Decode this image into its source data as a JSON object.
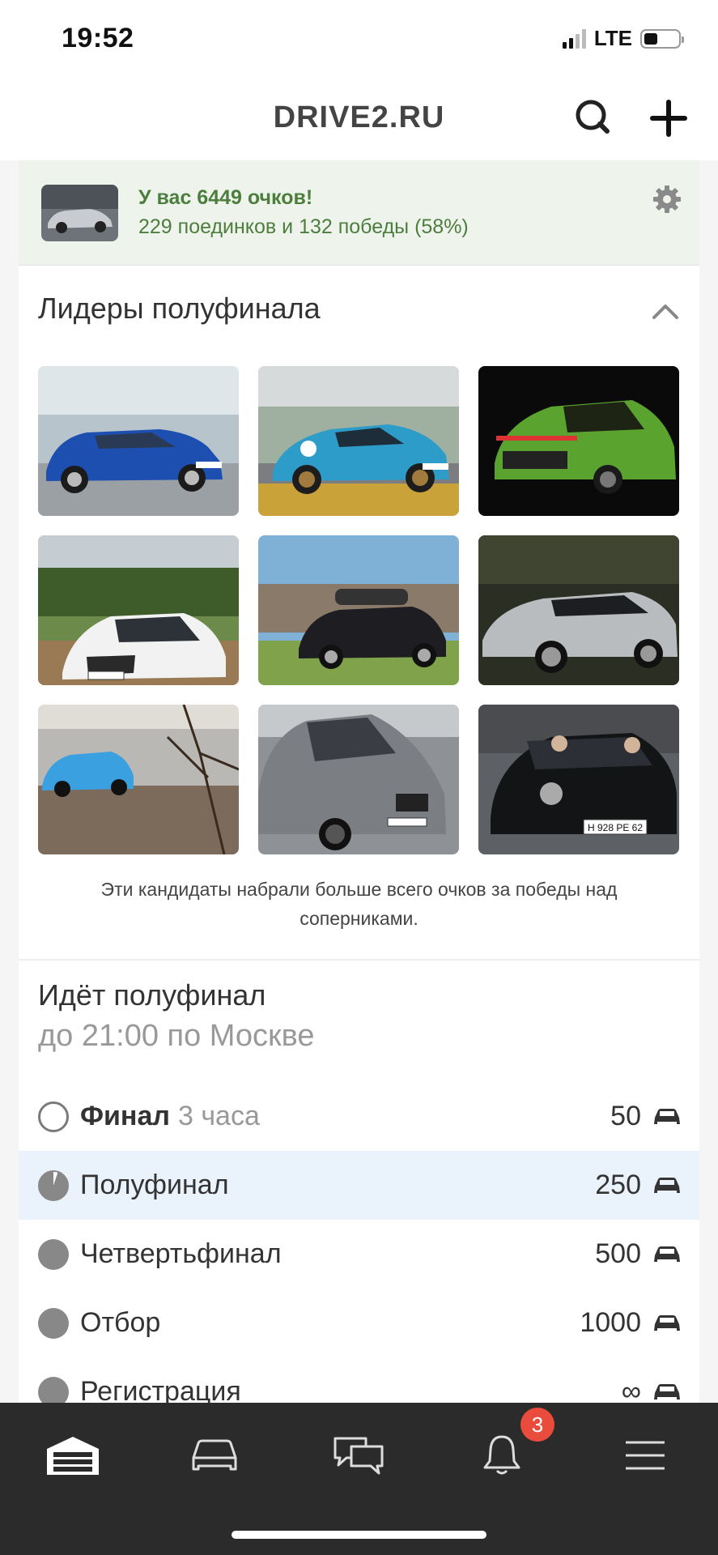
{
  "status_bar": {
    "time": "19:52",
    "network": "LTE",
    "battery_level": 0.4
  },
  "header": {
    "title": "DRIVE2.RU",
    "search_icon": "search-icon",
    "add_icon": "plus-icon"
  },
  "score": {
    "title": "У вас 6449 очков!",
    "subtitle": "229 поединков и 132 победы (58%)",
    "settings_icon": "gear-icon",
    "color": "#4d7e3e"
  },
  "leaders": {
    "title": "Лидеры полуфинала",
    "collapse_icon": "chevron-up-icon",
    "photos": [
      {
        "alt": "blue-sedan-photo",
        "plate": "A 963 C 190"
      },
      {
        "alt": "blue-porsche-photo",
        "plate": "T 966 PA"
      },
      {
        "alt": "green-suv-photo",
        "plate": ""
      },
      {
        "alt": "white-audi-photo",
        "plate": "A 463 C 190"
      },
      {
        "alt": "black-wagon-photo",
        "plate": ""
      },
      {
        "alt": "silver-sedan-photo",
        "plate": ""
      },
      {
        "alt": "blue-hatch-photo",
        "plate": ""
      },
      {
        "alt": "grey-skoda-photo",
        "plate": "AX 8811 MH"
      },
      {
        "alt": "black-porsche-photo",
        "plate": "H 928 PE 62"
      }
    ],
    "caption": "Эти кандидаты набрали больше всего очков за победы над соперниками."
  },
  "stage": {
    "title": "Идёт полуфинал",
    "subtitle": "до 21:00 по Москве",
    "rows": [
      {
        "name": "Финал",
        "duration": "3 часа",
        "value": "50",
        "state": "empty"
      },
      {
        "name": "Полуфинал",
        "duration": "",
        "value": "250",
        "state": "partial"
      },
      {
        "name": "Четвертьфинал",
        "duration": "",
        "value": "500",
        "state": "full"
      },
      {
        "name": "Отбор",
        "duration": "",
        "value": "1000",
        "state": "full"
      },
      {
        "name": "Регистрация",
        "duration": "",
        "value": "∞",
        "state": "full"
      }
    ]
  },
  "tabbar": {
    "tabs": [
      "garage-icon",
      "car-icon",
      "chat-icon",
      "bell-icon",
      "menu-icon"
    ],
    "notification_count": "3"
  }
}
